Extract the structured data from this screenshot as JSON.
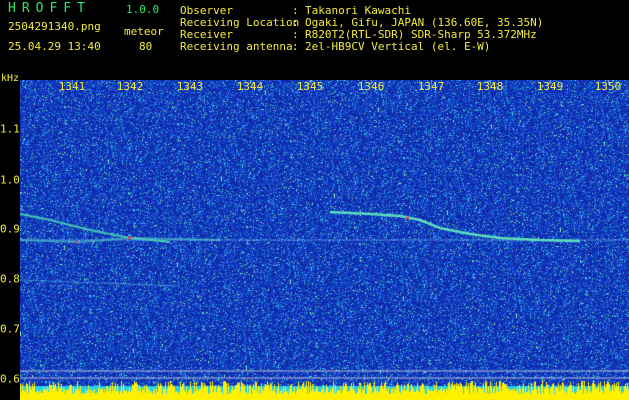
{
  "app": {
    "logo": "HROFFT",
    "version": "1.0.0",
    "filename": "2504291340.png",
    "datetime": "25.04.29 13:40",
    "mode_label": "meteor",
    "mode_value": "80"
  },
  "info": {
    "observer_label": "Observer",
    "observer_value": "Takanori Kawachi",
    "location_label": "Receiving Location",
    "location_value": "Ogaki, Gifu, JAPAN (136.60E, 35.35N)",
    "receiver_label": "Receiver",
    "receiver_value": "R820T2(RTL-SDR) SDR-Sharp 53.372MHz",
    "antenna_label": "Receiving antenna",
    "antenna_value": "2el-HB9CV Vertical (el. E-W)",
    "separator": ":"
  },
  "axes": {
    "y_unit": "kHz",
    "x_ticks": [
      "1341",
      "1342",
      "1343",
      "1344",
      "1345",
      "1346",
      "1347",
      "1348",
      "1349",
      "1350"
    ],
    "y_ticks": [
      "1.1",
      "1.0",
      "0.9",
      "0.8",
      "0.7",
      "0.6"
    ]
  },
  "colors": {
    "background": "#1228a0",
    "header_green": "#2fe66a",
    "header_yellow": "#f4ec3a",
    "baseline_band": "#ffee00",
    "trail": "#56f0b0"
  }
}
